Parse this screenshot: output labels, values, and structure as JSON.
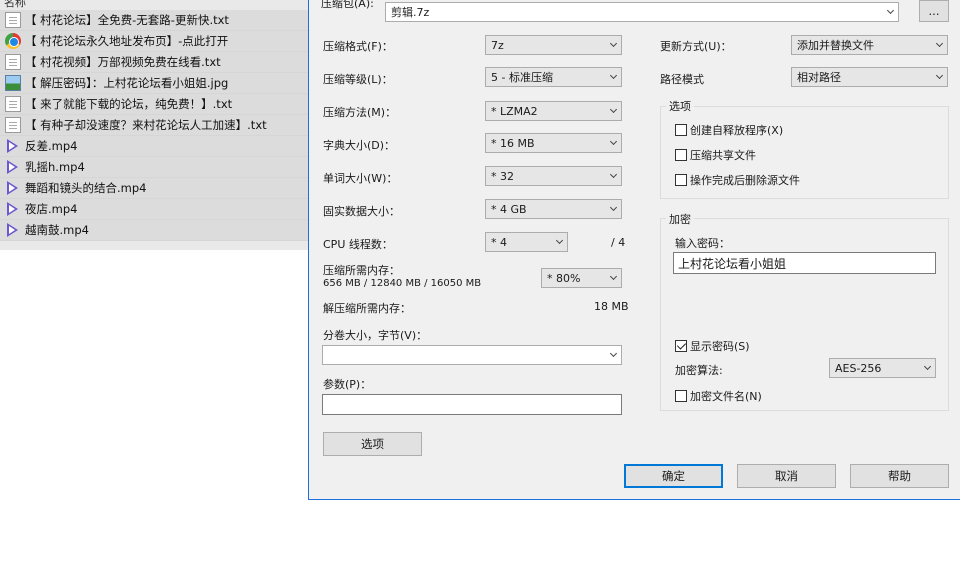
{
  "file_list": {
    "header": "名称",
    "items": [
      {
        "name": "【 村花论坛】全免费-无套路-更新快.txt",
        "icon": "text-file-icon"
      },
      {
        "name": "【 村花论坛永久地址发布页】-点此打开",
        "icon": "web-shortcut-icon"
      },
      {
        "name": "【 村花视频】万部视频免费在线看.txt",
        "icon": "text-file-icon"
      },
      {
        "name": "【 解压密码】：上村花论坛看小姐姐.jpg",
        "icon": "image-file-icon"
      },
      {
        "name": "【 来了就能下载的论坛，纯免费！】.txt",
        "icon": "text-file-icon"
      },
      {
        "name": "【 有种子却没速度？来村花论坛人工加速】.txt",
        "icon": "text-file-icon"
      },
      {
        "name": "反差.mp4",
        "icon": "video-file-icon"
      },
      {
        "name": "乳摇h.mp4",
        "icon": "video-file-icon"
      },
      {
        "name": "舞蹈和镜头的结合.mp4",
        "icon": "video-file-icon"
      },
      {
        "name": "夜店.mp4",
        "icon": "video-file-icon"
      },
      {
        "name": "越南鼓.mp4",
        "icon": "video-file-icon"
      }
    ]
  },
  "dialog": {
    "archive_label": "压缩包(A):",
    "archive_value": "剪辑.7z",
    "browse_label": "...",
    "format_label": "压缩格式(F)：",
    "format_value": "7z",
    "level_label": "压缩等级(L)：",
    "level_value": "5 - 标准压缩",
    "method_label": "压缩方法(M)：",
    "method_value": "* LZMA2",
    "dict_label": "字典大小(D)：",
    "dict_value": "* 16 MB",
    "word_label": "单词大小(W)：",
    "word_value": "* 32",
    "solid_label": "固实数据大小：",
    "solid_value": "* 4 GB",
    "cpu_label": "CPU 线程数：",
    "cpu_value": "* 4",
    "cpu_total": "/ 4",
    "mem_label": "压缩所需内存：",
    "mem_detail": "656 MB / 12840 MB / 16050 MB",
    "mem_percent": "* 80%",
    "decomp_label": "解压缩所需内存：",
    "decomp_value": "18 MB",
    "split_label": "分卷大小，字节(V)：",
    "split_value": "",
    "params_label": "参数(P)：",
    "params_value": "",
    "options_button": "选项",
    "update_label": "更新方式(U)：",
    "update_value": "添加并替换文件",
    "path_label": "路径模式",
    "path_value": "相对路径",
    "options_group": "选项",
    "opt_sfx": "创建自释放程序(X)",
    "opt_shared": "压缩共享文件",
    "opt_delete": "操作完成后删除源文件",
    "encrypt_group": "加密",
    "password_label": "输入密码：",
    "password_value": "上村花论坛看小姐姐",
    "show_password": "显示密码(S)",
    "algo_label": "加密算法:",
    "algo_value": "AES-256",
    "encrypt_names": "加密文件名(N)",
    "ok_button": "确定",
    "cancel_button": "取消",
    "help_button": "帮助"
  }
}
